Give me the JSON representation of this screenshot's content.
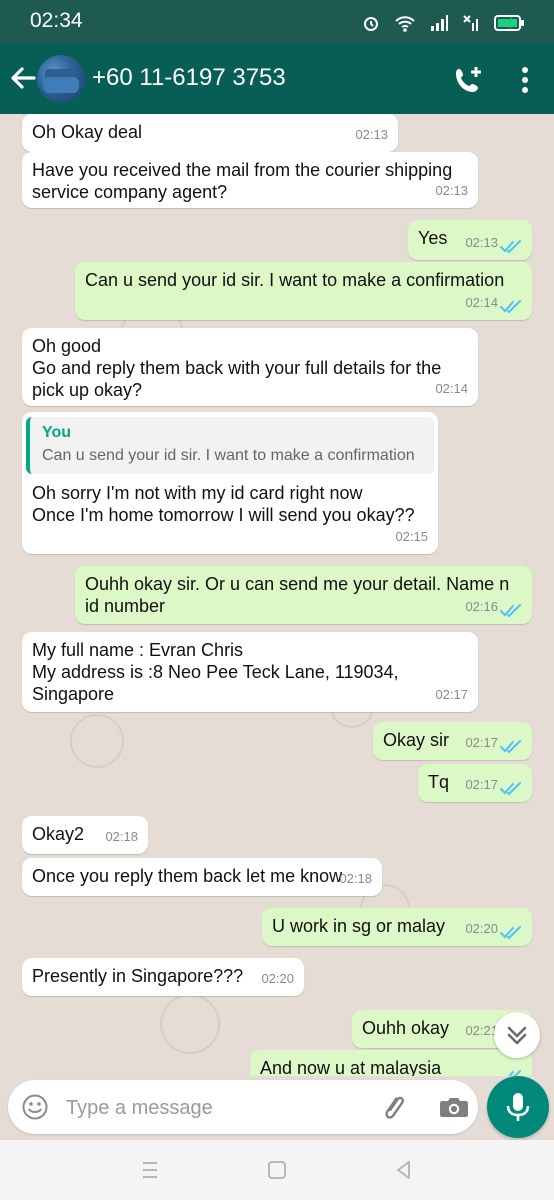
{
  "status_bar": {
    "time": "02:34"
  },
  "header": {
    "contact_name": "+60 11-6197 3753",
    "icons": [
      "back-arrow-icon",
      "avatar",
      "add-call-icon",
      "more-vertical-icon"
    ]
  },
  "messages": [
    {
      "dir": "in",
      "lines": [
        "Oh Okay deal"
      ],
      "time": "02:13"
    },
    {
      "dir": "in",
      "lines": [
        "Have you received the mail from the courier shipping",
        "service company agent?"
      ],
      "time": "02:13"
    },
    {
      "dir": "out",
      "lines": [
        "Yes"
      ],
      "time": "02:13",
      "status": "read"
    },
    {
      "dir": "out",
      "lines": [
        "Can u send your id sir. I want to make a confirmation"
      ],
      "time": "02:14",
      "status": "read"
    },
    {
      "dir": "in",
      "lines": [
        "Oh good",
        "Go and reply them back with your full details for the",
        "pick up okay?"
      ],
      "time": "02:14"
    },
    {
      "dir": "in",
      "quote": {
        "author": "You",
        "text": "Can u send your id sir. I want to make a confirmation"
      },
      "lines": [
        "Oh sorry I'm not with my id card right now",
        "Once I'm home tomorrow I will send you okay??"
      ],
      "time": "02:15"
    },
    {
      "dir": "out",
      "lines": [
        "Ouhh okay sir. Or u can send me your detail. Name n",
        "id number"
      ],
      "time": "02:16",
      "status": "read"
    },
    {
      "dir": "in",
      "lines": [
        "My full name : Evran Chris",
        "My address is :8 Neo Pee Teck Lane, 119034,",
        "Singapore"
      ],
      "time": "02:17"
    },
    {
      "dir": "out",
      "lines": [
        "Okay sir"
      ],
      "time": "02:17",
      "status": "read"
    },
    {
      "dir": "out",
      "lines": [
        "Tq"
      ],
      "time": "02:17",
      "status": "read"
    },
    {
      "dir": "in",
      "lines": [
        "Okay2"
      ],
      "time": "02:18"
    },
    {
      "dir": "in",
      "lines": [
        "Once you reply them back let me know"
      ],
      "time": "02:18"
    },
    {
      "dir": "out",
      "lines": [
        "U work in sg or malay"
      ],
      "time": "02:20",
      "status": "read"
    },
    {
      "dir": "in",
      "lines": [
        "Presently in Singapore???"
      ],
      "time": "02:20"
    },
    {
      "dir": "out",
      "lines": [
        "Ouhh okay"
      ],
      "time": "02:21",
      "status": "read"
    },
    {
      "dir": "out",
      "lines": [
        "And now u at malaysia"
      ],
      "time": "",
      "status": "read"
    }
  ],
  "composer": {
    "placeholder": "Type a message",
    "icons": [
      "emoji-icon",
      "attach-icon",
      "camera-icon",
      "mic-icon"
    ]
  },
  "colors": {
    "status_bar": "#1e5a51",
    "app_bar": "#075e54",
    "incoming_bubble": "#ffffff",
    "outgoing_bubble": "#dcf8c6",
    "read_tick": "#4fc3f7",
    "accent": "#00897b",
    "chat_background": "#e5ddd5"
  }
}
